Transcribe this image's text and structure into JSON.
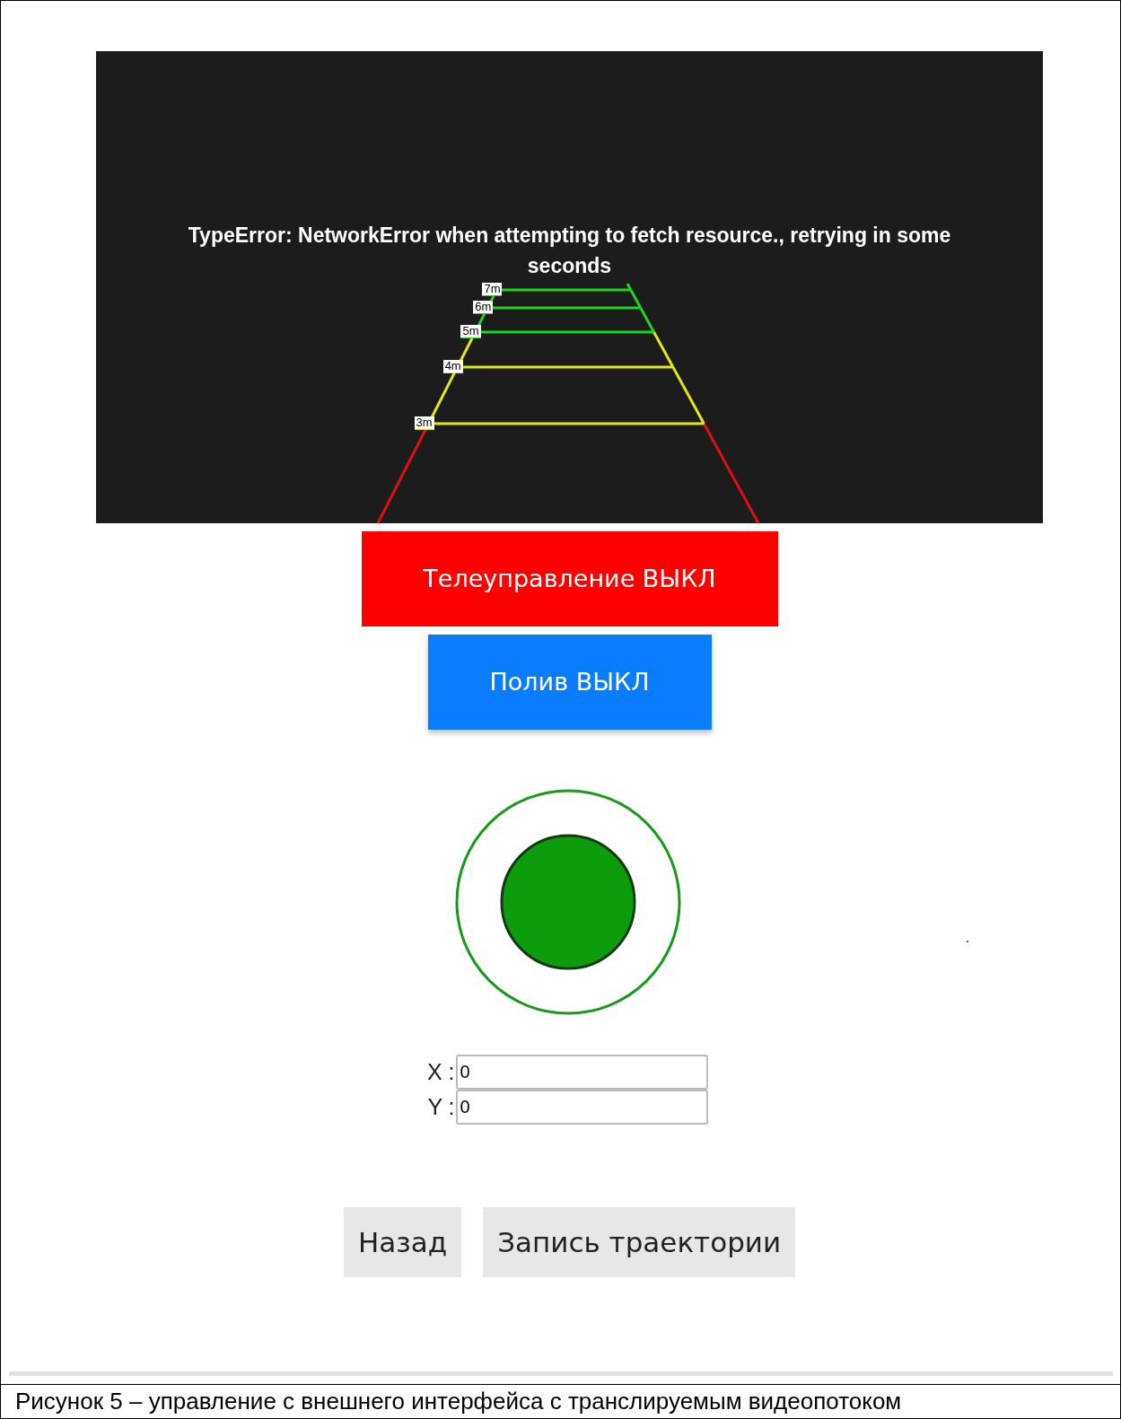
{
  "video": {
    "error_message": "TypeError: NetworkError when attempting to fetch resource., retrying in some seconds",
    "guides": [
      {
        "label": "7m",
        "color": "#1fd21f"
      },
      {
        "label": "6m",
        "color": "#1fd21f"
      },
      {
        "label": "5m",
        "color": "#1fd21f"
      },
      {
        "label": "4m",
        "color": "#e6e619"
      },
      {
        "label": "3m",
        "color": "#e6e619"
      }
    ]
  },
  "buttons": [
    {
      "label": "Телеуправление ВЫКЛ",
      "color": "#ff0000"
    },
    {
      "label": "Полив ВЫКЛ",
      "color": "#0a7cff"
    }
  ],
  "fields": [
    {
      "label": "X :",
      "value": "0"
    },
    {
      "label": "Y :",
      "value": "0"
    }
  ],
  "actions": [
    "Назад",
    "Запись траектории"
  ],
  "caption": "Рисунок 5 – управление с внешнего интерфейса с транслируемым видеопотоком"
}
